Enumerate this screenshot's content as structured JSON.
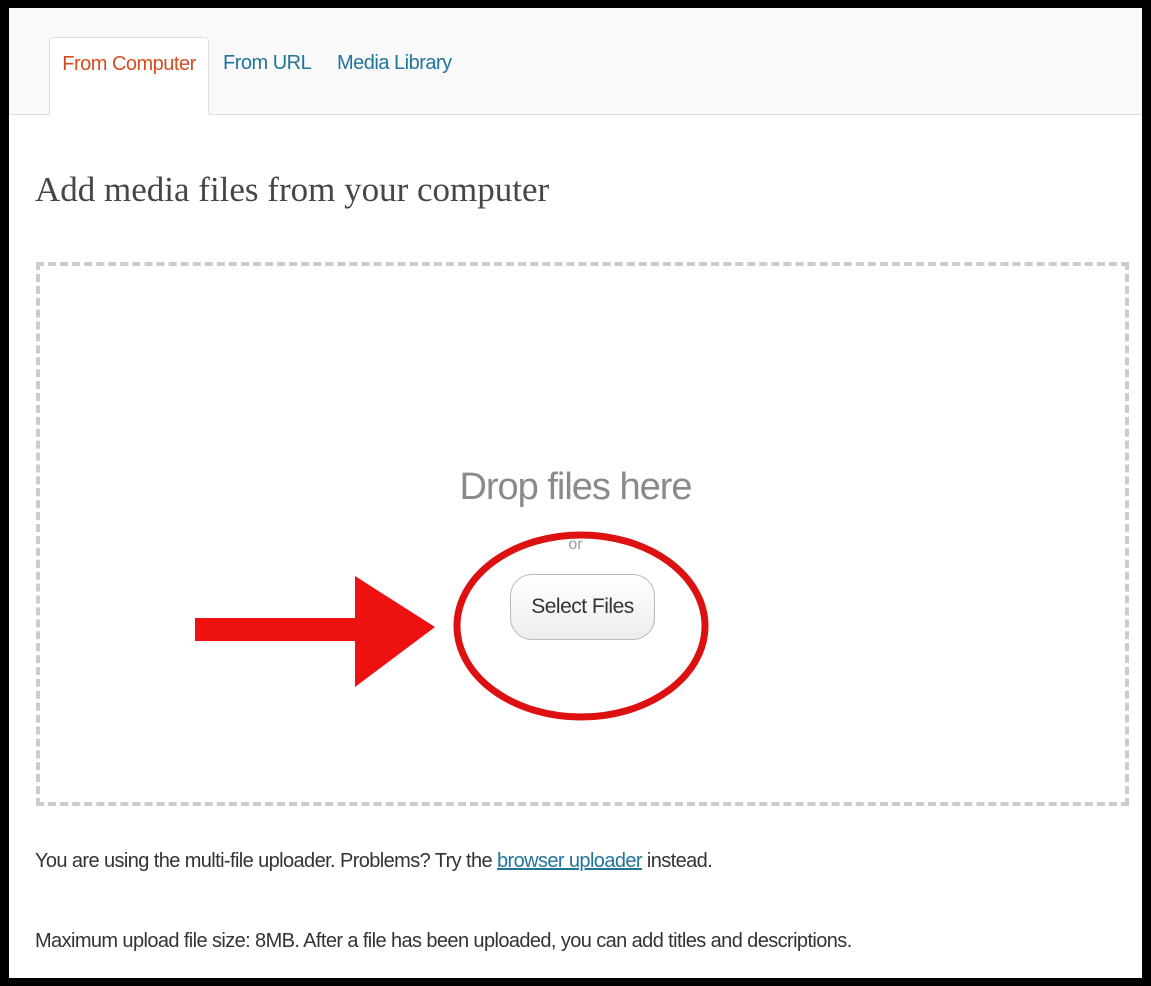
{
  "tabs": [
    {
      "label": "From Computer",
      "active": true
    },
    {
      "label": "From URL",
      "active": false
    },
    {
      "label": "Media Library",
      "active": false
    }
  ],
  "page_title": "Add media files from your computer",
  "dropzone": {
    "label": "Drop files here",
    "or_label": "or",
    "select_button_label": "Select Files"
  },
  "uploader_notice": {
    "before_link": "You are using the multi-file uploader. Problems? Try the ",
    "link_text": "browser uploader",
    "after_link": " instead."
  },
  "max_upload_notice": "Maximum upload file size: 8MB. After a file has been uploaded, you can add titles and descriptions.",
  "annotations": {
    "arrow_color": "#ee1111",
    "circle_color": "#dd1111"
  },
  "colors": {
    "active_tab": "#d54e21",
    "link": "#21759b"
  }
}
